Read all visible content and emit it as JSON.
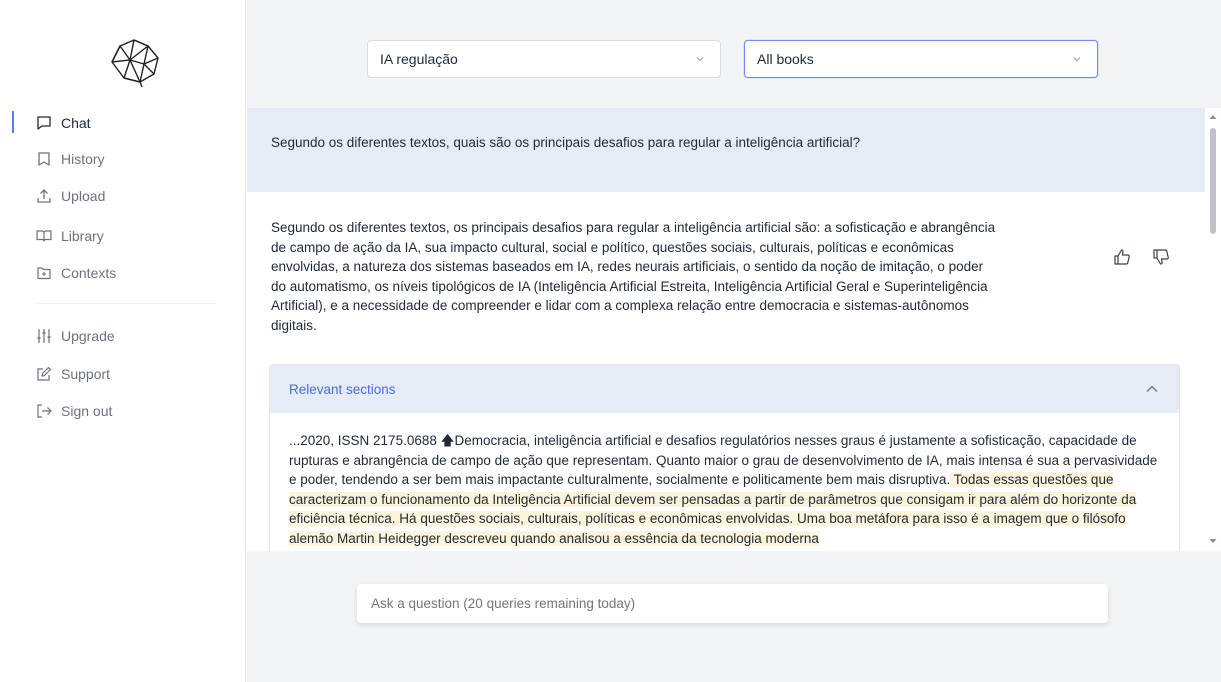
{
  "colors": {
    "accent": "#5b7cf2",
    "question_bg": "#e6ecf5",
    "main_bg": "#f3f4f6",
    "highlight": "#fdf4dc"
  },
  "sidebar": {
    "logo_icon": "neural-network-logo",
    "items": [
      {
        "label": "Chat",
        "icon": "chat-bubble-icon",
        "active": true
      },
      {
        "label": "History",
        "icon": "bookmark-icon"
      },
      {
        "label": "Upload",
        "icon": "upload-icon"
      },
      {
        "label": "Library",
        "icon": "book-open-icon"
      },
      {
        "label": "Contexts",
        "icon": "folder-icon"
      },
      {
        "label": "Upgrade",
        "icon": "sliders-icon"
      },
      {
        "label": "Support",
        "icon": "edit-icon"
      },
      {
        "label": "Sign out",
        "icon": "sign-out-icon"
      }
    ]
  },
  "topbar": {
    "context_select": {
      "value": "IA regulação"
    },
    "books_select": {
      "value": "All books"
    }
  },
  "chat": {
    "question": "Segundo os diferentes textos, quais são os principais desafios para regular a inteligência artificial?",
    "answer": "Segundo os diferentes textos, os principais desafios para regular a inteligência artificial são: a sofisticação e abrangência de campo de ação da IA, sua impacto cultural, social e político, questões sociais, culturais, políticas e econômicas envolvidas, a natureza dos sistemas baseados em IA, redes neurais artificiais, o sentido da noção de imitação, o poder do automatismo, os níveis tipológicos de IA (Inteligência Artificial Estreita, Inteligência Artificial Geral e Superinteligência Artificial), e a necessidade de compreender e lidar com a complexa relação entre democracia e sistemas-autônomos digitais.",
    "relevant": {
      "title": "Relevant sections",
      "text_before": "...2020, ISSN 2175.0688 🡅Democracia, inteligência artificial e desafios regulatórios nesses graus é justamente a sofisticação, capacidade de rupturas e abrangência de campo de ação que representam. Quanto maior o grau de desenvolvimento de IA, mais intensa é sua a pervasividade e poder, tendendo a ser bem mais impactante culturalmente, socialmente e politicamente bem mais disruptiva.",
      "text_highlight": " Todas essas questões que caracterizam o funcionamento da Inteligência Artificial devem ser pensadas a partir de parâmetros que consigam ir para além do horizonte da eficiência técnica. Há questões sociais, culturais, políticas e econômicas envolvidas. Uma boa metáfora para isso é a imagem que o filósofo alemão Martin Heidegger descreveu quando analisou a essência da tecnologia moderna"
    }
  },
  "ask": {
    "placeholder": "Ask a question (20 queries remaining today)"
  }
}
